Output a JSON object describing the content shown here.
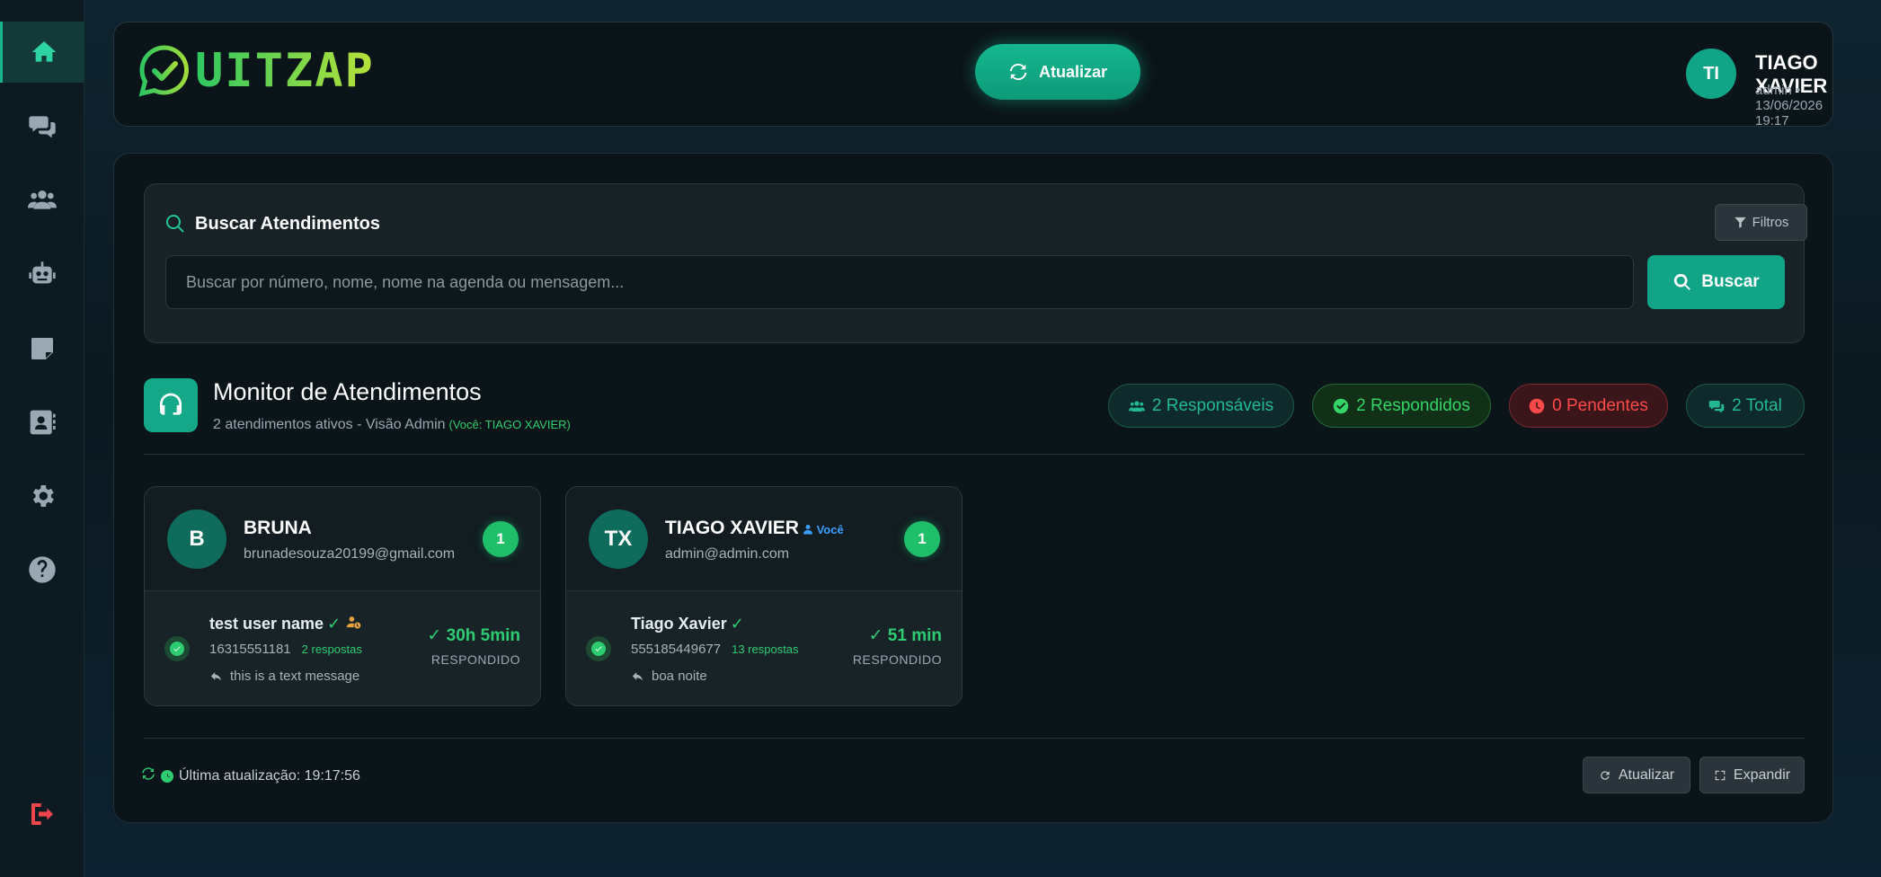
{
  "sidebar": {
    "items": [
      {
        "icon": "home-icon"
      },
      {
        "icon": "chat-icon"
      },
      {
        "icon": "users-icon"
      },
      {
        "icon": "robot-icon"
      },
      {
        "icon": "note-icon"
      },
      {
        "icon": "contacts-icon"
      },
      {
        "icon": "settings-icon"
      },
      {
        "icon": "help-icon"
      }
    ],
    "logout_icon": "logout-icon"
  },
  "header": {
    "logo_text": "UITZAP",
    "refresh_label": "Atualizar",
    "user": {
      "initials": "TI",
      "name": "TIAGO XAVIER",
      "meta": "admin • 13/06/2026 19:17"
    }
  },
  "search": {
    "title": "Buscar Atendimentos",
    "filters_label": "Filtros",
    "placeholder": "Buscar por número, nome, nome na agenda ou mensagem...",
    "value": "",
    "button_label": "Buscar"
  },
  "monitor": {
    "title": "Monitor de Atendimentos",
    "subtitle": "2 atendimentos ativos - Visão Admin",
    "you_label": "(Você: TIAGO XAVIER)",
    "stats": {
      "responsaveis": "2 Responsáveis",
      "respondidos": "2 Respondidos",
      "pendentes": "0 Pendentes",
      "total": "2 Total"
    }
  },
  "cards": [
    {
      "initials": "B",
      "name": "BRUNA",
      "email": "brunadesouza20199@gmail.com",
      "count": "1",
      "contact": {
        "name": "test user name",
        "tick": "✓",
        "phone": "16315551181",
        "replies": "2 respostas",
        "last_message": "this is a text message",
        "time": "✓ 30h 5min",
        "status": "RESPONDIDO"
      }
    },
    {
      "initials": "TX",
      "name": "TIAGO XAVIER",
      "you_tag": "Você",
      "email": "admin@admin.com",
      "count": "1",
      "contact": {
        "name": "Tiago Xavier",
        "tick": "✓",
        "phone": "555185449677",
        "replies": "13 respostas",
        "last_message": "boa noite",
        "time": "✓ 51 min",
        "status": "RESPONDIDO"
      }
    }
  ],
  "footer": {
    "last_update": "Última atualização: 19:17:56",
    "refresh_label": "Atualizar",
    "expand_label": "Expandir"
  },
  "colors": {
    "accent": "#12a486",
    "success": "#2ecc71",
    "danger": "#ff4a4a",
    "link": "#3aa0ff"
  }
}
